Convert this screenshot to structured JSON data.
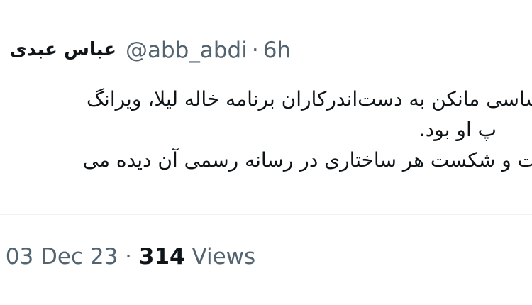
{
  "author": {
    "display_name": "عباس عبدی",
    "handle": "@abb_abdi",
    "separator": "·",
    "time_ago": "6h"
  },
  "tweet": {
    "lines": [
      "ساسی مانکن به دست‌اندرکاران برنامه خاله لیلا، ویرانگ",
      "پ او بود.",
      "ت و شکست هر ساختاری در رسانه رسمی آن دیده می"
    ]
  },
  "footer": {
    "date": "03 Dec 23",
    "separator_prefix": "·",
    "separator": "·",
    "views_count": "314",
    "views_label": "Views"
  },
  "colors": {
    "text_primary": "#0f1419",
    "text_secondary": "#536471",
    "divider": "#eff3f4",
    "background": "#ffffff"
  }
}
